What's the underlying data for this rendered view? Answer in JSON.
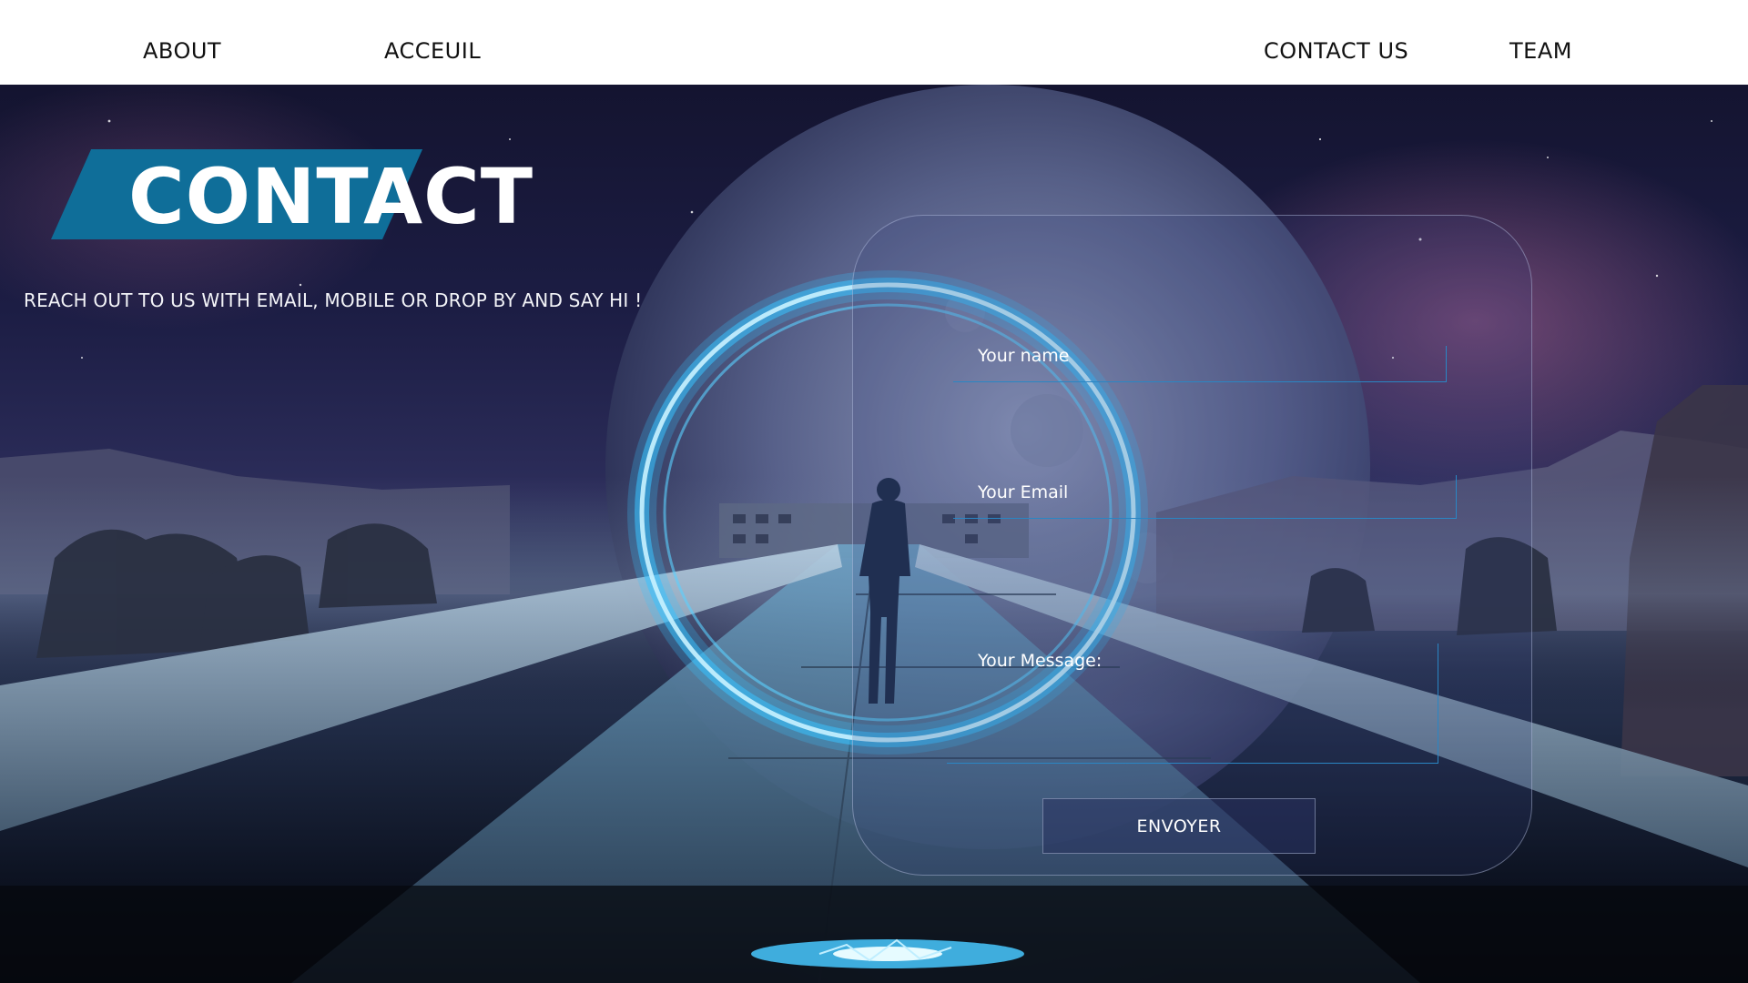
{
  "nav": {
    "about": "ABOUT",
    "acceuil": "ACCEUIL",
    "contact_us": "CONTACT US",
    "team": "TEAM"
  },
  "hero": {
    "title": "CONTACT",
    "subtitle": "REACH OUT TO US WITH EMAIL, MOBILE OR DROP BY AND SAY HI !"
  },
  "form": {
    "name_label": "Your name",
    "email_label": "Your Email",
    "message_label": "Your Message:",
    "submit_label": "ENVOYER"
  },
  "colors": {
    "banner": "#0f6e99",
    "field_border": "#2a86c4",
    "portal_glow": "#39c3ff"
  }
}
